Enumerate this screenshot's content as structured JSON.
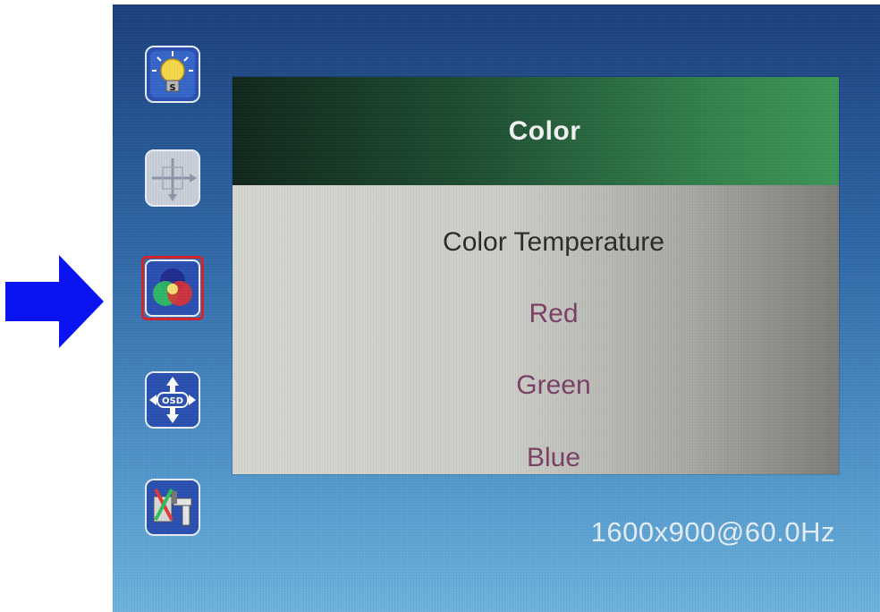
{
  "menu": {
    "title": "Color",
    "items": [
      {
        "label": "Color Temperature",
        "state": "active"
      },
      {
        "label": "Red",
        "state": "dim"
      },
      {
        "label": "Green",
        "state": "dim"
      },
      {
        "label": "Blue",
        "state": "dim"
      }
    ]
  },
  "sidebar": {
    "icons": [
      {
        "name": "brightness-bulb-icon",
        "selected": false
      },
      {
        "name": "position-cross-icon",
        "selected": false
      },
      {
        "name": "color-circles-icon",
        "selected": true
      },
      {
        "name": "osd-arrows-icon",
        "selected": false
      },
      {
        "name": "setup-tools-icon",
        "selected": false
      }
    ]
  },
  "status": {
    "resolution": "1600x900@60.0Hz"
  },
  "pointer": {
    "icon": "right-arrow-icon",
    "color": "#0a14f0"
  },
  "colors": {
    "selection_outline": "#d8202a",
    "header_green": "#33824d",
    "item_dim": "#7a3f66",
    "item_active": "#2a2a2a"
  }
}
